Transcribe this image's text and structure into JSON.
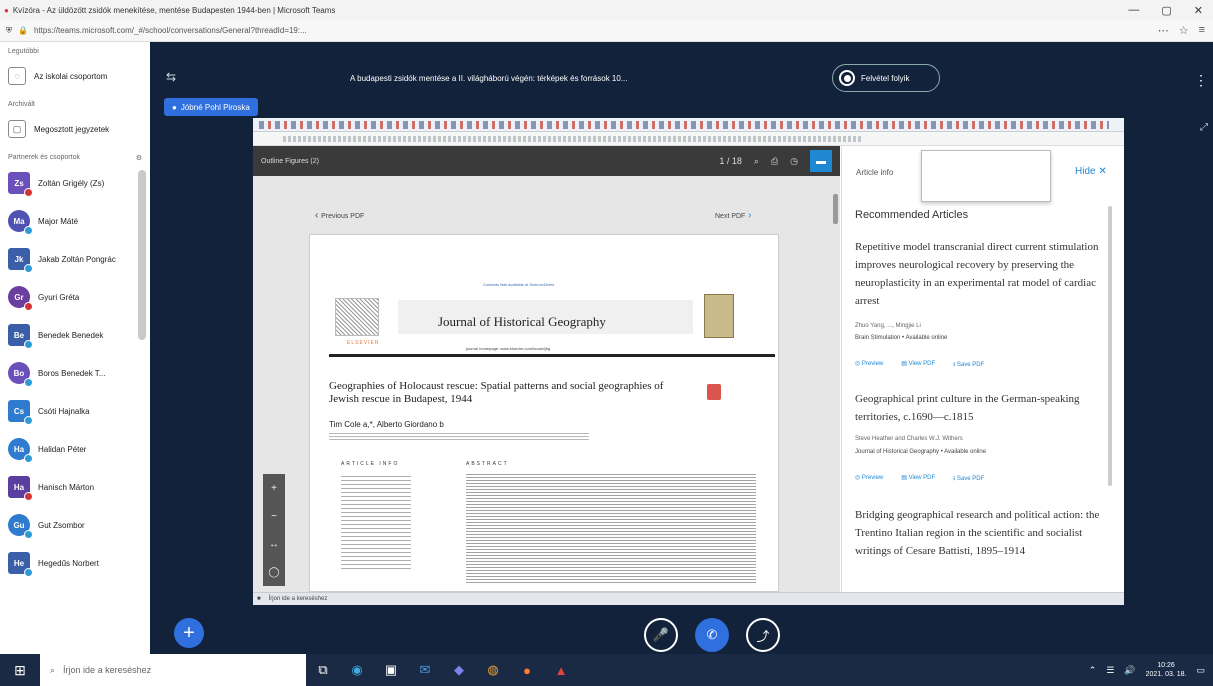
{
  "browser": {
    "title": "Kvízóra - Az üldözött zsidók menekítése, mentése Budapesten 1944-ben | Microsoft Teams",
    "url": "https://teams.microsoft.com/_#/school/conversations/General?threadId=19:...",
    "window_controls": [
      "—",
      "▢",
      "✕"
    ],
    "toolbar_icons": [
      "⋯",
      "☆",
      "≡"
    ]
  },
  "sidebar": {
    "section_recent": "Legutóbbi",
    "item_my_team": "Az iskolai csoportom",
    "section_archive": "Archivált",
    "item_notes": "Megosztott jegyzetek",
    "section_contacts": "Partnerek és csoportok",
    "people": [
      {
        "initials": "Zs",
        "name": "Zoltán Grigély (Zs)",
        "color": "#6b4fbb",
        "status": "#d13438"
      },
      {
        "initials": "Ma",
        "name": "Major Máté",
        "color": "#4f52b2",
        "status": "#2e9ad4"
      },
      {
        "initials": "Jk",
        "name": "Jakab Zoltán Pongrác",
        "color": "#3a5fa8",
        "status": "#2e9ad4"
      },
      {
        "initials": "Gr",
        "name": "Gyuri Gréta",
        "color": "#6b3fa0",
        "status": "#d13438"
      },
      {
        "initials": "Be",
        "name": "Benedek Benedek",
        "color": "#3a5fa8",
        "status": "#2e9ad4"
      },
      {
        "initials": "Bo",
        "name": "Boros Benedek T...",
        "color": "#6b4fbb",
        "status": "#2e9ad4"
      },
      {
        "initials": "Cs",
        "name": "Csóti Hajnalka",
        "color": "#2e7bcf",
        "status": "#2e9ad4"
      },
      {
        "initials": "Ha",
        "name": "Halidan Péter",
        "color": "#2e7bcf",
        "status": "#2e9ad4"
      },
      {
        "initials": "Ha",
        "name": "Hanisch Márton",
        "color": "#5a3fa0",
        "status": "#d13438"
      },
      {
        "initials": "Gu",
        "name": "Gut Zsombor",
        "color": "#2e7bcf",
        "status": "#2e9ad4"
      },
      {
        "initials": "He",
        "name": "Hegedűs Norbert",
        "color": "#3a5fa8",
        "status": "#2e9ad4"
      }
    ]
  },
  "meeting": {
    "title": "A budapesti zsidók mentése a II. világháború végén: térképek és források 10...",
    "presenter": "Jóbné Pohl Piroska",
    "rec_label": "Felvétel folyik",
    "sidebar_toggle": "⇆",
    "more": "⋮",
    "collapse": "⤢"
  },
  "pdf_viewer": {
    "outline_label": "Outline   Figures (2)",
    "page_indicator": "1 / 18",
    "prev": "Previous PDF",
    "next": "Next PDF",
    "journal_link": "Contents lists available at ScienceDirect",
    "journal_title": "Journal of Historical Geography",
    "journal_sub": "journal homepage: www.elsevier.com/locate/jhg",
    "elsevier": "ELSEVIER",
    "article_title": "Geographies of Holocaust rescue: Spatial patterns and social geographies of Jewish rescue in Budapest, 1944",
    "authors": "Tim Cole a,*, Alberto Giordano b",
    "article_info": "ARTICLE INFO",
    "abstract": "ABSTRACT",
    "zoom": [
      "+",
      "−",
      "↔",
      "◯"
    ]
  },
  "right_panel": {
    "tab": "Article info",
    "hide": "Hide ✕",
    "recommended": "Recommended Articles",
    "articles": [
      {
        "title": "Repetitive model transcranial direct current stimulation improves neurological recovery by preserving the neuroplasticity in an experimental rat model of cardiac arrest",
        "authors": "Zhuo Yang, ..., Mingjie Li",
        "journal": "Brain Stimulation • Available online",
        "actions": [
          "◎ Preview",
          "▤ View PDF",
          "⭳ Save PDF"
        ]
      },
      {
        "title": "Geographical print culture in the German-speaking territories, c.1690—c.1815",
        "authors": "Steve Heather and Charles W.J. Withers",
        "journal": "Journal of Historical Geography • Available online",
        "actions": [
          "◎ Preview",
          "▤ View PDF",
          "⭳ Save PDF"
        ]
      },
      {
        "title": "Bridging geographical research and political action: the Trentino Italian region in the scientific and socialist writings of Cesare Battisti, 1895–1914",
        "authors": "",
        "journal": "",
        "actions": []
      }
    ]
  },
  "inner_taskbar": {
    "search": "Írjon ide a kereséshez"
  },
  "call_controls": {
    "mic": "🎤",
    "call": "✆",
    "share": "⤴"
  },
  "taskbar": {
    "search_placeholder": "Írjon ide a kereséshez",
    "time": "10:26",
    "date": "2021. 03. 18."
  }
}
